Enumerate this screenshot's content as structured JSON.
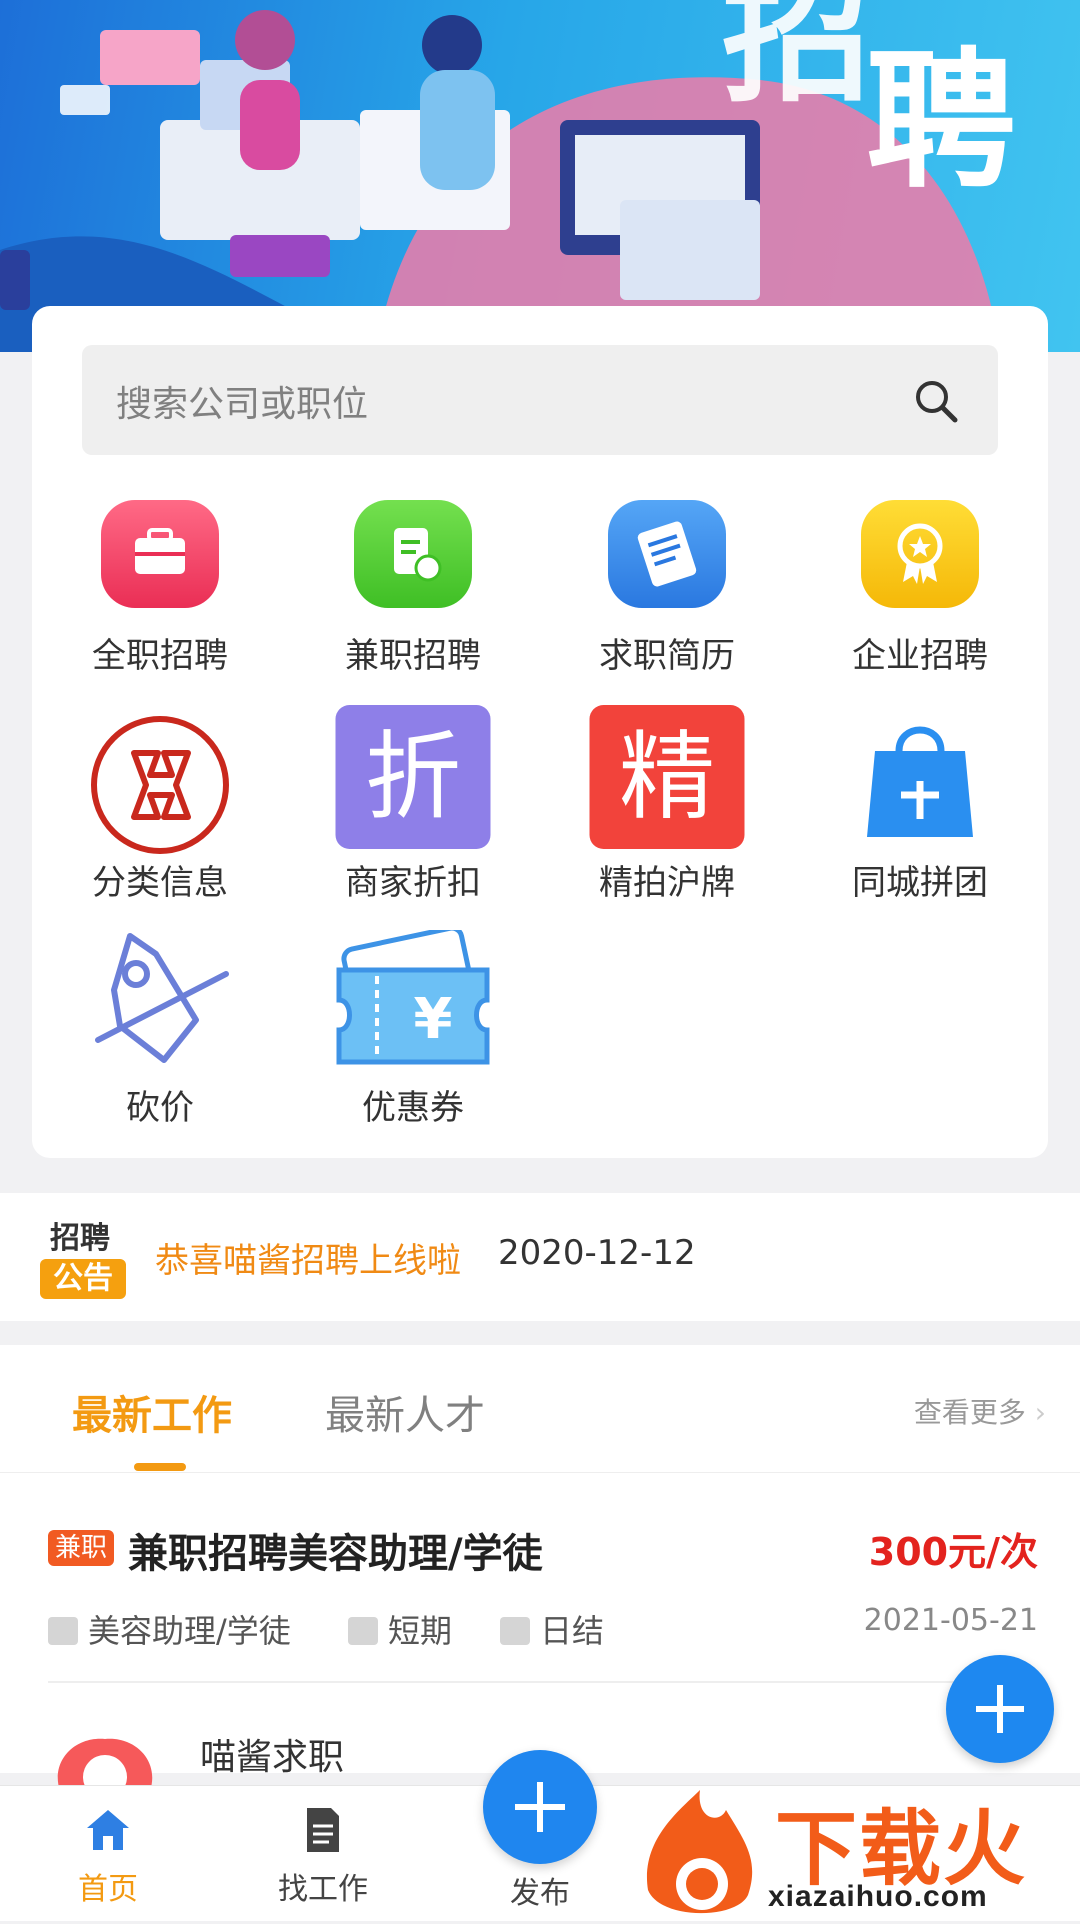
{
  "banner": {
    "title_c1": "招",
    "title_c2": "聘"
  },
  "search": {
    "placeholder": "搜索公司或职位"
  },
  "grid": [
    {
      "label": "全职招聘",
      "icon": "briefcase-icon",
      "color": "#f23d61"
    },
    {
      "label": "兼职招聘",
      "icon": "document-clock-icon",
      "color": "#4ec92e"
    },
    {
      "label": "求职简历",
      "icon": "resume-icon",
      "color": "#2f84ea"
    },
    {
      "label": "企业招聘",
      "icon": "medal-icon",
      "color": "#f5c315"
    },
    {
      "label": "分类信息",
      "icon": "category-icon",
      "color": "#c9281d"
    },
    {
      "label": "商家折扣",
      "icon": "discount-icon",
      "color": "#8e7fe8",
      "glyph": "折"
    },
    {
      "label": "精拍沪牌",
      "icon": "license-plate-icon",
      "color": "#f2433b",
      "glyph": "精"
    },
    {
      "label": "同城拼团",
      "icon": "shopping-bag-icon",
      "color": "#2a8ff0"
    },
    {
      "label": "砍价",
      "icon": "price-tag-icon",
      "color": "#6b7fd8"
    },
    {
      "label": "优惠券",
      "icon": "coupon-icon",
      "color": "#5ab2f2",
      "glyph": "¥"
    }
  ],
  "notice": {
    "tag_top": "招聘",
    "tag_bottom": "公告",
    "message": "恭喜喵酱招聘上线啦",
    "date": "2020-12-12"
  },
  "tabs": {
    "active": "最新工作",
    "inactive": "最新人才",
    "more": "查看更多"
  },
  "job": {
    "badge": "兼职",
    "title": "兼职招聘美容助理/学徒",
    "salary": "300元/次",
    "position": "美容助理/学徒",
    "term": "短期",
    "settlement": "日结",
    "date": "2021-05-21"
  },
  "seeker": {
    "name": "喵酱求职"
  },
  "bottom_nav": {
    "home": "首页",
    "jobs": "找工作",
    "publish": "发布"
  },
  "watermark": {
    "brand": "下载火",
    "domain": "xiazaihuo.com"
  }
}
